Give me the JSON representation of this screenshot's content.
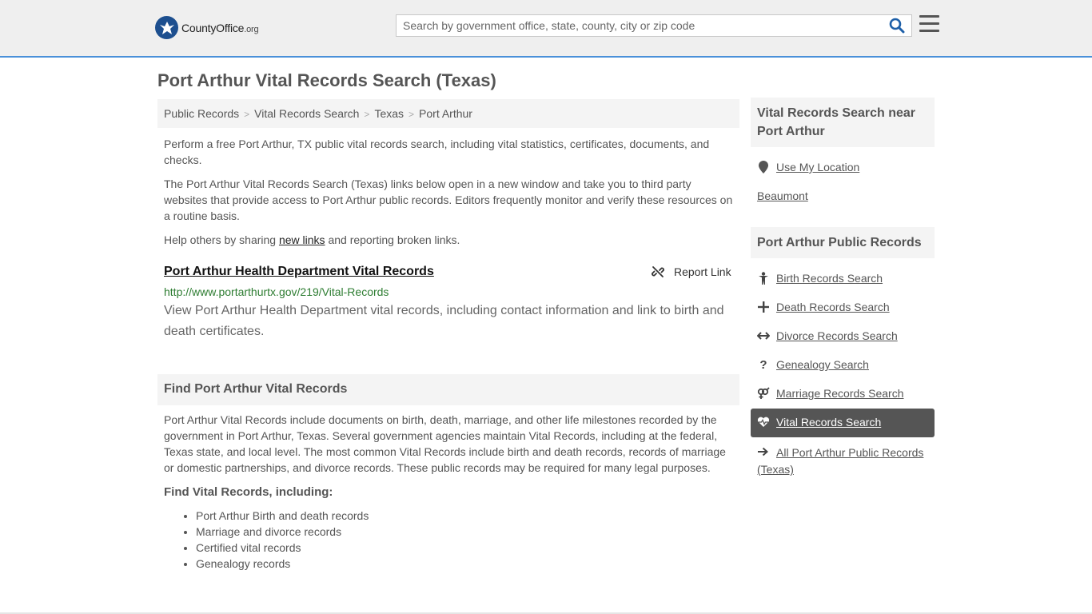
{
  "header": {
    "logo_main": "CountyOffice",
    "logo_org": ".org",
    "search_placeholder": "Search by government office, state, county, city or zip code"
  },
  "page_title": "Port Arthur Vital Records Search (Texas)",
  "breadcrumb": [
    "Public Records",
    "Vital Records Search",
    "Texas",
    "Port Arthur"
  ],
  "intro": {
    "p1": "Perform a free Port Arthur, TX public vital records search, including vital statistics, certificates, documents, and checks.",
    "p2": "The Port Arthur Vital Records Search (Texas) links below open in a new window and take you to third party websites that provide access to Port Arthur public records. Editors frequently monitor and verify these resources on a routine basis.",
    "p3_before": "Help others by sharing ",
    "p3_link": "new links",
    "p3_after": " and reporting broken links."
  },
  "listing": {
    "title": "Port Arthur Health Department Vital Records",
    "report_label": "Report Link",
    "url": "http://www.portarthurtx.gov/219/Vital-Records",
    "description": "View Port Arthur Health Department vital records, including contact information and link to birth and death certificates."
  },
  "find_section": {
    "heading": "Find Port Arthur Vital Records",
    "body": "Port Arthur Vital Records include documents on birth, death, marriage, and other life milestones recorded by the government in Port Arthur, Texas. Several government agencies maintain Vital Records, including at the federal, Texas state, and local level. The most common Vital Records include birth and death records, records of marriage or domestic partnerships, and divorce records. These public records may be required for many legal purposes.",
    "subheading": "Find Vital Records, including:",
    "bullets": [
      "Port Arthur Birth and death records",
      "Marriage and divorce records",
      "Certified vital records",
      "Genealogy records"
    ]
  },
  "sidebar": {
    "nearby_heading": "Vital Records Search near Port Arthur",
    "use_location": "Use My Location",
    "nearby_city": "Beaumont",
    "public_heading": "Port Arthur Public Records",
    "items": [
      {
        "label": "Birth Records Search",
        "icon": "child-icon"
      },
      {
        "label": "Death Records Search",
        "icon": "cross-icon"
      },
      {
        "label": "Divorce Records Search",
        "icon": "split-arrows-icon"
      },
      {
        "label": "Genealogy Search",
        "icon": "question-icon"
      },
      {
        "label": "Marriage Records Search",
        "icon": "gender-symbol-icon"
      }
    ],
    "active_item": "Vital Records Search",
    "all_records": "All Port Arthur Public Records (Texas)"
  },
  "colors": {
    "header_bg": "#efefef",
    "header_border": "#4a90d9",
    "link_green": "#2e7d32",
    "active_bg": "#555555"
  }
}
